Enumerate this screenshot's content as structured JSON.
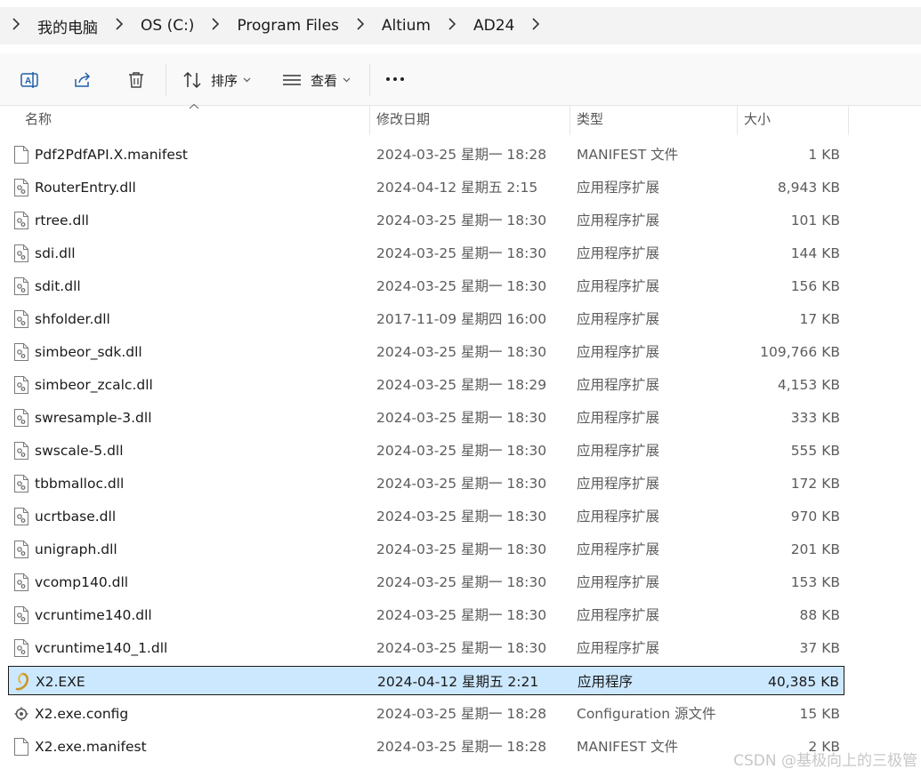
{
  "breadcrumb": {
    "items": [
      "我的电脑",
      "OS (C:)",
      "Program Files",
      "Altium",
      "AD24"
    ]
  },
  "toolbar": {
    "rename_icon": "rename-icon",
    "share_icon": "share-icon",
    "delete_icon": "trash-icon",
    "sort_label": "排序",
    "view_label": "查看",
    "more_icon": "more-icon"
  },
  "columns": {
    "name": "名称",
    "date": "修改日期",
    "type": "类型",
    "size": "大小"
  },
  "files": [
    {
      "name": "Pdf2PdfAPI.X.manifest",
      "date": "2024-03-25 星期一 18:28",
      "type": "MANIFEST 文件",
      "size": "1 KB",
      "icon": "blank-file-icon"
    },
    {
      "name": "RouterEntry.dll",
      "date": "2024-04-12 星期五 2:15",
      "type": "应用程序扩展",
      "size": "8,943 KB",
      "icon": "dll-file-icon"
    },
    {
      "name": "rtree.dll",
      "date": "2024-03-25 星期一 18:30",
      "type": "应用程序扩展",
      "size": "101 KB",
      "icon": "dll-file-icon"
    },
    {
      "name": "sdi.dll",
      "date": "2024-03-25 星期一 18:30",
      "type": "应用程序扩展",
      "size": "144 KB",
      "icon": "dll-file-icon"
    },
    {
      "name": "sdit.dll",
      "date": "2024-03-25 星期一 18:30",
      "type": "应用程序扩展",
      "size": "156 KB",
      "icon": "dll-file-icon"
    },
    {
      "name": "shfolder.dll",
      "date": "2017-11-09 星期四 16:00",
      "type": "应用程序扩展",
      "size": "17 KB",
      "icon": "dll-file-icon"
    },
    {
      "name": "simbeor_sdk.dll",
      "date": "2024-03-25 星期一 18:30",
      "type": "应用程序扩展",
      "size": "109,766 KB",
      "icon": "dll-file-icon"
    },
    {
      "name": "simbeor_zcalc.dll",
      "date": "2024-03-25 星期一 18:29",
      "type": "应用程序扩展",
      "size": "4,153 KB",
      "icon": "dll-file-icon"
    },
    {
      "name": "swresample-3.dll",
      "date": "2024-03-25 星期一 18:30",
      "type": "应用程序扩展",
      "size": "333 KB",
      "icon": "dll-file-icon"
    },
    {
      "name": "swscale-5.dll",
      "date": "2024-03-25 星期一 18:30",
      "type": "应用程序扩展",
      "size": "555 KB",
      "icon": "dll-file-icon"
    },
    {
      "name": "tbbmalloc.dll",
      "date": "2024-03-25 星期一 18:30",
      "type": "应用程序扩展",
      "size": "172 KB",
      "icon": "dll-file-icon"
    },
    {
      "name": "ucrtbase.dll",
      "date": "2024-03-25 星期一 18:30",
      "type": "应用程序扩展",
      "size": "970 KB",
      "icon": "dll-file-icon"
    },
    {
      "name": "unigraph.dll",
      "date": "2024-03-25 星期一 18:30",
      "type": "应用程序扩展",
      "size": "201 KB",
      "icon": "dll-file-icon"
    },
    {
      "name": "vcomp140.dll",
      "date": "2024-03-25 星期一 18:30",
      "type": "应用程序扩展",
      "size": "153 KB",
      "icon": "dll-file-icon"
    },
    {
      "name": "vcruntime140.dll",
      "date": "2024-03-25 星期一 18:30",
      "type": "应用程序扩展",
      "size": "88 KB",
      "icon": "dll-file-icon"
    },
    {
      "name": "vcruntime140_1.dll",
      "date": "2024-03-25 星期一 18:30",
      "type": "应用程序扩展",
      "size": "37 KB",
      "icon": "dll-file-icon"
    },
    {
      "name": "X2.EXE",
      "date": "2024-04-12 星期五 2:21",
      "type": "应用程序",
      "size": "40,385 KB",
      "icon": "altium-app-icon",
      "selected": true
    },
    {
      "name": "X2.exe.config",
      "date": "2024-03-25 星期一 18:28",
      "type": "Configuration 源文件",
      "size": "15 KB",
      "icon": "config-file-icon"
    },
    {
      "name": "X2.exe.manifest",
      "date": "2024-03-25 星期一 18:28",
      "type": "MANIFEST 文件",
      "size": "2 KB",
      "icon": "blank-file-icon"
    }
  ],
  "watermark": "CSDN @基极向上的三极管",
  "colors": {
    "selection_bg": "#cce8ff",
    "toolbar_bg": "#f9f9f9",
    "addressbar_bg": "#f3f3f3"
  }
}
